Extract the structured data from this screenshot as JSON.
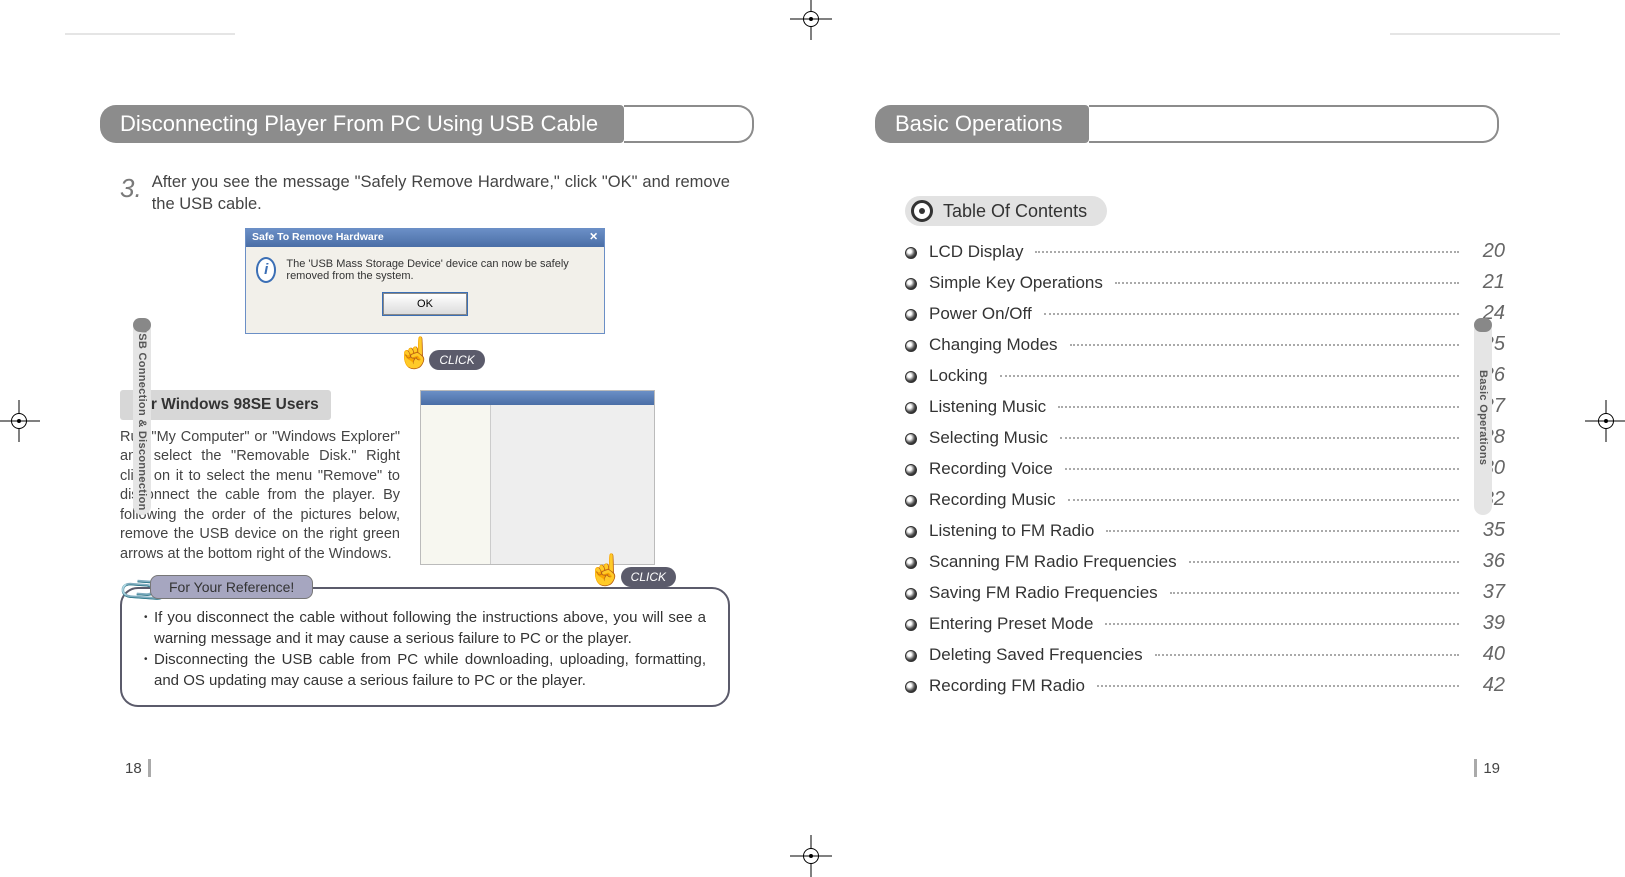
{
  "left": {
    "side_tab": "USB Connection & Disconnection",
    "heading": "Disconnecting Player From PC Using USB Cable",
    "step_num": "3.",
    "step_text": "After you see the message \"Safely Remove Hardware,\" click \"OK\" and remove the USB cable.",
    "dialog_title": "Safe To Remove Hardware",
    "dialog_msg": "The 'USB Mass Storage Device' device can now be safely removed from the system.",
    "dialog_ok": "OK",
    "click_label": "CLICK",
    "win98_heading": "For Windows 98SE Users",
    "win98_body": "Run \"My Computer\" or \"Windows Explorer\" and select the \"Removable Disk.\" Right click on it to select the menu \"Remove\" to disconnect the cable from the player. By following the order of the pictures below, remove the USB device on the right green arrows at the bottom right of the Windows.",
    "note_tab": "For Your Reference!",
    "note_items": [
      "If you disconnect the cable without following the instructions above, you will see a warning message and it may cause a serious failure to PC or the player.",
      "Disconnecting the USB cable from PC while downloading, uploading, formatting, and OS updating may cause a serious failure to PC or the player."
    ],
    "page_number": "18"
  },
  "right": {
    "side_tab": "Basic Operations",
    "heading": "Basic Operations",
    "toc_heading": "Table Of Contents",
    "toc": [
      {
        "label": "LCD Display",
        "page": "20"
      },
      {
        "label": "Simple Key Operations",
        "page": "21"
      },
      {
        "label": "Power On/Off",
        "page": "24"
      },
      {
        "label": "Changing Modes",
        "page": "25"
      },
      {
        "label": "Locking",
        "page": "26"
      },
      {
        "label": "Listening Music",
        "page": "27"
      },
      {
        "label": "Selecting Music",
        "page": "28"
      },
      {
        "label": "Recording Voice",
        "page": "30"
      },
      {
        "label": "Recording Music",
        "page": "32"
      },
      {
        "label": "Listening to FM Radio",
        "page": "35"
      },
      {
        "label": "Scanning FM Radio Frequencies",
        "page": "36"
      },
      {
        "label": "Saving FM Radio Frequencies",
        "page": "37"
      },
      {
        "label": "Entering Preset Mode",
        "page": "39"
      },
      {
        "label": "Deleting Saved Frequencies",
        "page": "40"
      },
      {
        "label": "Recording FM Radio",
        "page": "42"
      }
    ],
    "page_number": "19"
  }
}
